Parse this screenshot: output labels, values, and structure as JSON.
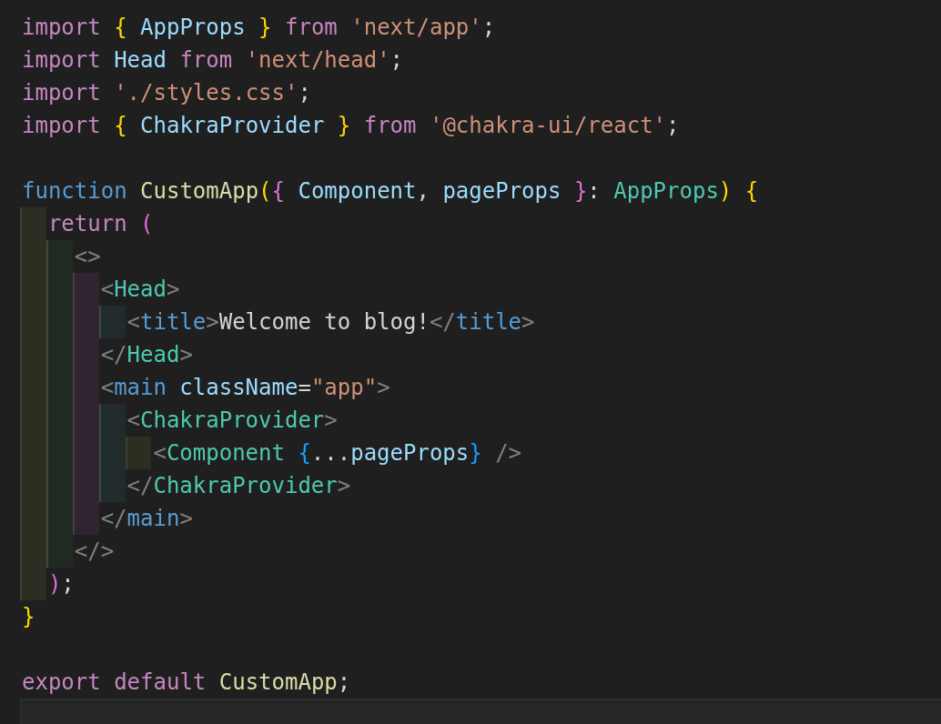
{
  "editor": {
    "lines": [
      {
        "kind": "code",
        "tokens": [
          {
            "kind": "kw",
            "text": "import "
          },
          {
            "kind": "b1",
            "text": "{"
          },
          {
            "kind": "var",
            "text": " AppProps "
          },
          {
            "kind": "b1",
            "text": "}"
          },
          {
            "kind": "kw",
            "text": " from "
          },
          {
            "kind": "str",
            "text": "'next/app'"
          },
          {
            "kind": "punct",
            "text": ";"
          }
        ]
      },
      {
        "kind": "code",
        "tokens": [
          {
            "kind": "kw",
            "text": "import"
          },
          {
            "kind": "var",
            "text": " Head"
          },
          {
            "kind": "kw",
            "text": " from "
          },
          {
            "kind": "str",
            "text": "'next/head'"
          },
          {
            "kind": "punct",
            "text": ";"
          }
        ]
      },
      {
        "kind": "code",
        "tokens": [
          {
            "kind": "kw",
            "text": "import "
          },
          {
            "kind": "str",
            "text": "'./styles.css'"
          },
          {
            "kind": "punct",
            "text": ";"
          }
        ]
      },
      {
        "kind": "code",
        "tokens": [
          {
            "kind": "kw",
            "text": "import "
          },
          {
            "kind": "b1",
            "text": "{"
          },
          {
            "kind": "var",
            "text": " ChakraProvider "
          },
          {
            "kind": "b1",
            "text": "}"
          },
          {
            "kind": "kw",
            "text": " from "
          },
          {
            "kind": "str",
            "text": "'@chakra-ui/react'"
          },
          {
            "kind": "punct",
            "text": ";"
          }
        ]
      },
      {
        "kind": "blank"
      },
      {
        "kind": "code",
        "tokens": [
          {
            "kind": "decl",
            "text": "function"
          },
          {
            "kind": "fn",
            "text": " CustomApp"
          },
          {
            "kind": "b1",
            "text": "("
          },
          {
            "kind": "b2",
            "text": "{"
          },
          {
            "kind": "var",
            "text": " Component"
          },
          {
            "kind": "punct",
            "text": ", "
          },
          {
            "kind": "var",
            "text": "pageProps "
          },
          {
            "kind": "b2",
            "text": "}"
          },
          {
            "kind": "punct",
            "text": ": "
          },
          {
            "kind": "type",
            "text": "AppProps"
          },
          {
            "kind": "b1",
            "text": ") {"
          }
        ],
        "children": [
          {
            "kind": "code",
            "tokens": [
              {
                "kind": "kw",
                "text": "return "
              },
              {
                "kind": "b2",
                "text": "("
              }
            ],
            "children": [
              {
                "kind": "code",
                "tokens": [
                  {
                    "kind": "tagp",
                    "text": "<>"
                  }
                ],
                "children": [
                  {
                    "kind": "code",
                    "tokens": [
                      {
                        "kind": "tagp",
                        "text": "<"
                      },
                      {
                        "kind": "comp",
                        "text": "Head"
                      },
                      {
                        "kind": "tagp",
                        "text": ">"
                      }
                    ],
                    "children": [
                      {
                        "kind": "code",
                        "tokens": [
                          {
                            "kind": "tagp",
                            "text": "<"
                          },
                          {
                            "kind": "tag",
                            "text": "title"
                          },
                          {
                            "kind": "tagp",
                            "text": ">"
                          },
                          {
                            "kind": "text",
                            "text": "Welcome to blog!"
                          },
                          {
                            "kind": "tagp",
                            "text": "</"
                          },
                          {
                            "kind": "tag",
                            "text": "title"
                          },
                          {
                            "kind": "tagp",
                            "text": ">"
                          }
                        ]
                      }
                    ]
                  },
                  {
                    "kind": "code",
                    "tokens": [
                      {
                        "kind": "tagp",
                        "text": "</"
                      },
                      {
                        "kind": "comp",
                        "text": "Head"
                      },
                      {
                        "kind": "tagp",
                        "text": ">"
                      }
                    ]
                  },
                  {
                    "kind": "code",
                    "tokens": [
                      {
                        "kind": "tagp",
                        "text": "<"
                      },
                      {
                        "kind": "tag",
                        "text": "main"
                      },
                      {
                        "kind": "attr",
                        "text": " className"
                      },
                      {
                        "kind": "punct",
                        "text": "="
                      },
                      {
                        "kind": "str",
                        "text": "\"app\""
                      },
                      {
                        "kind": "tagp",
                        "text": ">"
                      }
                    ],
                    "children": [
                      {
                        "kind": "code",
                        "tokens": [
                          {
                            "kind": "tagp",
                            "text": "<"
                          },
                          {
                            "kind": "comp",
                            "text": "ChakraProvider"
                          },
                          {
                            "kind": "tagp",
                            "text": ">"
                          }
                        ],
                        "children": [
                          {
                            "kind": "code",
                            "tokens": [
                              {
                                "kind": "tagp",
                                "text": "<"
                              },
                              {
                                "kind": "comp",
                                "text": "Component "
                              },
                              {
                                "kind": "b3",
                                "text": "{"
                              },
                              {
                                "kind": "punct",
                                "text": "..."
                              },
                              {
                                "kind": "var",
                                "text": "pageProps"
                              },
                              {
                                "kind": "b3",
                                "text": "}"
                              },
                              {
                                "kind": "tagp",
                                "text": " />"
                              }
                            ]
                          }
                        ]
                      },
                      {
                        "kind": "code",
                        "tokens": [
                          {
                            "kind": "tagp",
                            "text": "</"
                          },
                          {
                            "kind": "comp",
                            "text": "ChakraProvider"
                          },
                          {
                            "kind": "tagp",
                            "text": ">"
                          }
                        ]
                      }
                    ]
                  },
                  {
                    "kind": "code",
                    "tokens": [
                      {
                        "kind": "tagp",
                        "text": "</"
                      },
                      {
                        "kind": "tag",
                        "text": "main"
                      },
                      {
                        "kind": "tagp",
                        "text": ">"
                      }
                    ]
                  }
                ]
              },
              {
                "kind": "code",
                "tokens": [
                  {
                    "kind": "tagp",
                    "text": "</>"
                  }
                ]
              }
            ]
          },
          {
            "kind": "code",
            "tokens": [
              {
                "kind": "b2",
                "text": ")"
              },
              {
                "kind": "punct",
                "text": ";"
              }
            ]
          }
        ]
      },
      {
        "kind": "code",
        "tokens": [
          {
            "kind": "b1",
            "text": "}"
          }
        ]
      },
      {
        "kind": "blank"
      },
      {
        "kind": "code",
        "tokens": [
          {
            "kind": "kw",
            "text": "export default"
          },
          {
            "kind": "fn",
            "text": " CustomApp"
          },
          {
            "kind": "punct",
            "text": ";"
          }
        ]
      },
      {
        "kind": "current"
      }
    ]
  }
}
